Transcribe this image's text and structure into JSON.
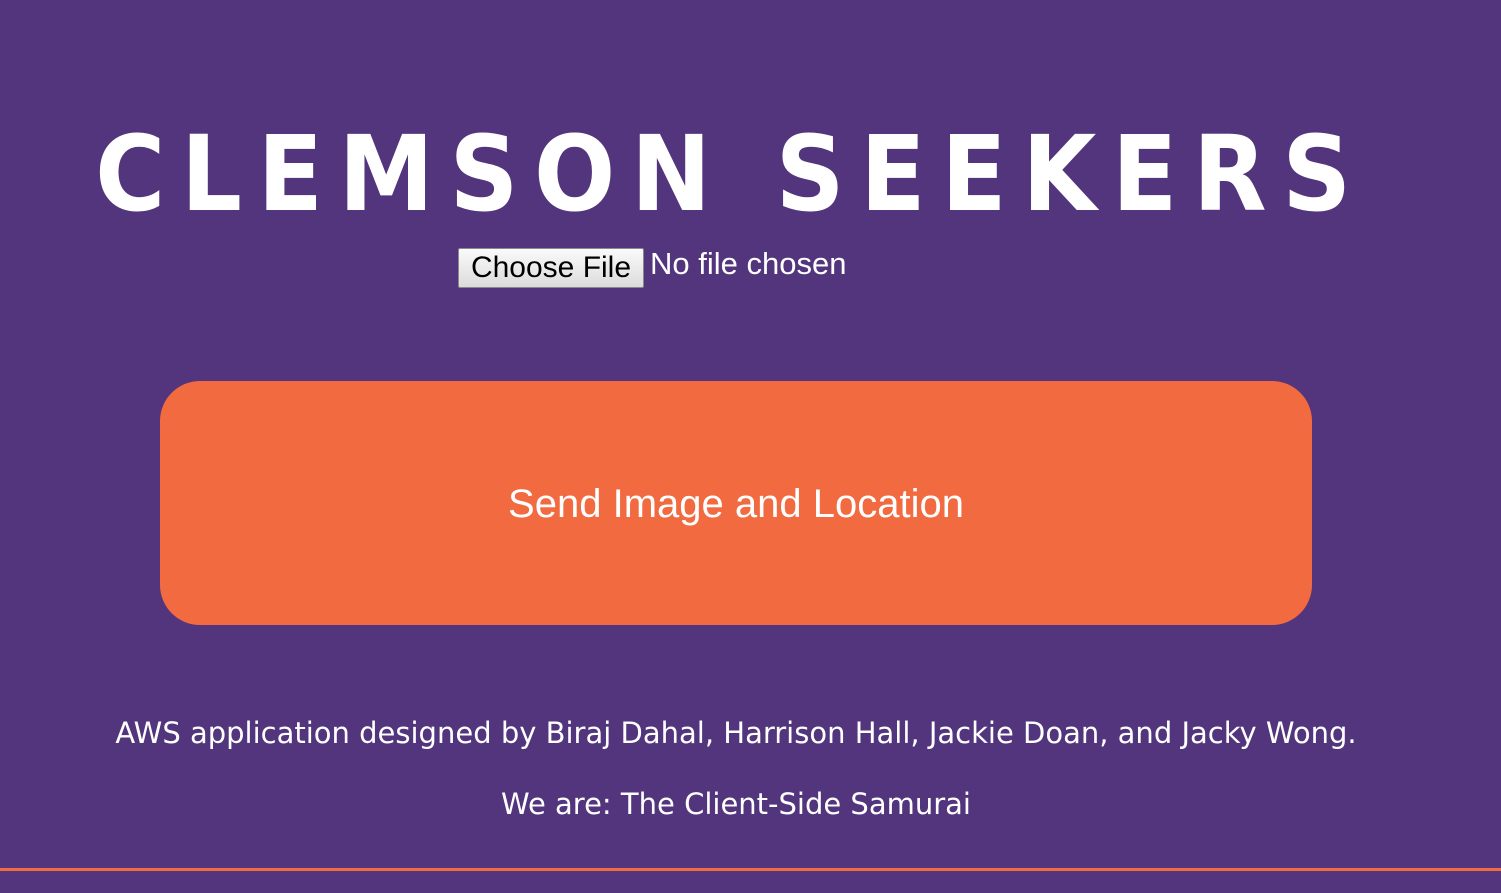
{
  "header": {
    "title": "CLEMSON SEEKERS"
  },
  "upload": {
    "choose_file_label": "Choose File",
    "file_status": "No file chosen"
  },
  "actions": {
    "send_label": "Send Image and Location"
  },
  "footer": {
    "credits": "AWS application designed by Biraj Dahal, Harrison Hall, Jackie Doan, and Jacky Wong.",
    "team": "We are: The Client-Side Samurai"
  },
  "colors": {
    "background": "#52357c",
    "accent": "#f26a40",
    "text": "#ffffff"
  }
}
